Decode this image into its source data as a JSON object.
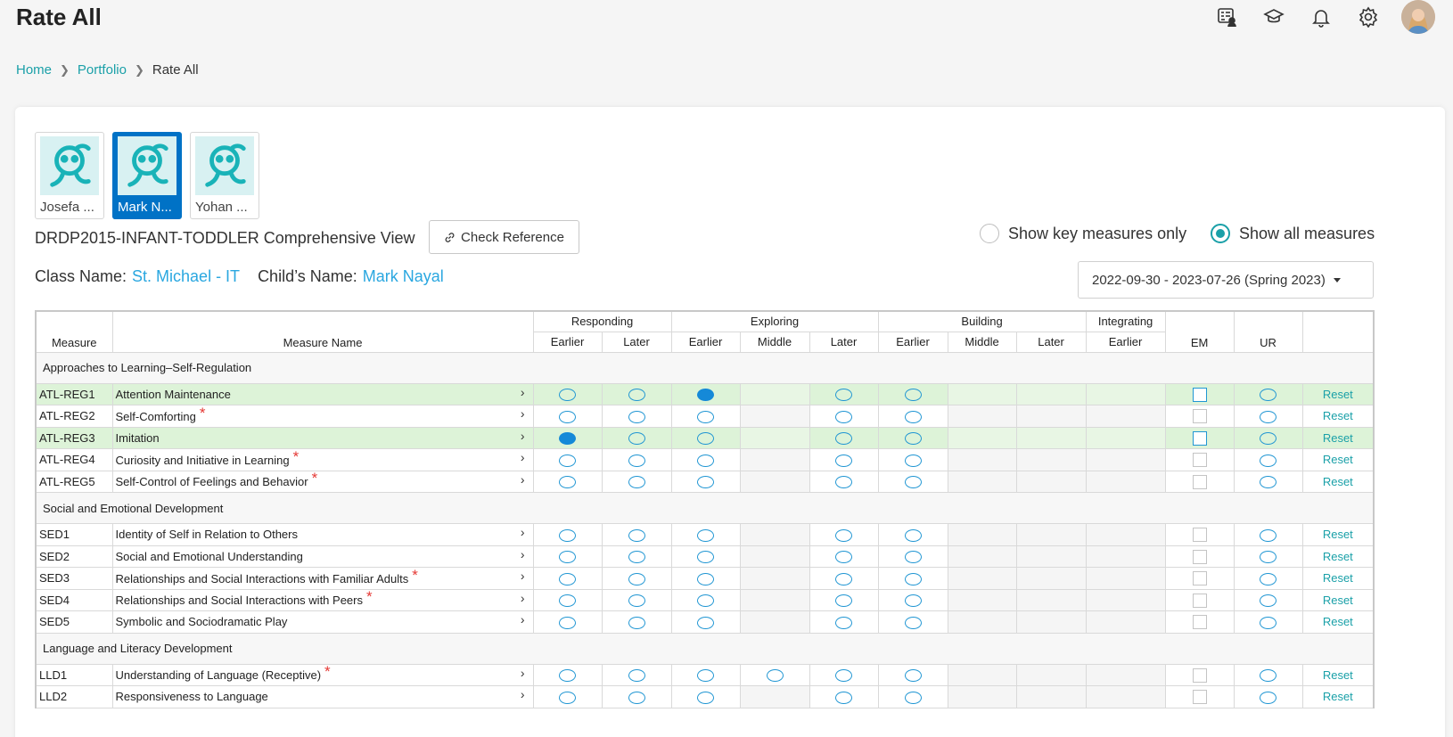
{
  "header": {
    "title": "Rate All"
  },
  "top_icons": [
    "report-icon",
    "graduation-cap-icon",
    "bell-icon",
    "gear-icon"
  ],
  "breadcrumb": {
    "home": "Home",
    "portfolio": "Portfolio",
    "current": "Rate All"
  },
  "children": [
    {
      "name": "Josefa ...",
      "selected": false
    },
    {
      "name": "Mark N...",
      "selected": true
    },
    {
      "name": "Yohan ...",
      "selected": false
    }
  ],
  "view": {
    "title": "DRDP2015-INFANT-TODDLER Comprehensive View",
    "check_reference": "Check Reference",
    "key_measures_label": "Show key measures only",
    "all_measures_label": "Show all measures",
    "selected_option": "all"
  },
  "info": {
    "class_label": "Class Name:",
    "class_value": "St. Michael - IT",
    "child_label": "Child’s Name:",
    "child_value": "Mark Nayal"
  },
  "date_range": "2022-09-30 - 2023-07-26 (Spring 2023)",
  "table": {
    "headers": {
      "measure": "Measure",
      "measure_name": "Measure Name",
      "groups": [
        "Responding",
        "Exploring",
        "Building",
        "Integrating"
      ],
      "levels": [
        "Earlier",
        "Later",
        "Earlier",
        "Middle",
        "Later",
        "Earlier",
        "Middle",
        "Later",
        "Earlier"
      ],
      "em": "EM",
      "ur": "UR"
    },
    "reset_label": "Reset",
    "sections": [
      {
        "title": "Approaches to Learning–Self-Regulation",
        "rows": [
          {
            "code": "ATL-REG1",
            "name": "Attention Maintenance",
            "key": false,
            "highlight": true,
            "selected": 2,
            "middle": false
          },
          {
            "code": "ATL-REG2",
            "name": "Self-Comforting",
            "key": true,
            "highlight": false,
            "selected": -1,
            "middle": false
          },
          {
            "code": "ATL-REG3",
            "name": "Imitation",
            "key": false,
            "highlight": true,
            "selected": 0,
            "middle": false
          },
          {
            "code": "ATL-REG4",
            "name": "Curiosity and Initiative in Learning",
            "key": true,
            "highlight": false,
            "selected": -1,
            "middle": false
          },
          {
            "code": "ATL-REG5",
            "name": "Self-Control of Feelings and Behavior",
            "key": true,
            "highlight": false,
            "selected": -1,
            "middle": false
          }
        ]
      },
      {
        "title": "Social and Emotional Development",
        "rows": [
          {
            "code": "SED1",
            "name": "Identity of Self in Relation to Others",
            "key": false,
            "highlight": false,
            "selected": -1,
            "middle": false
          },
          {
            "code": "SED2",
            "name": "Social and Emotional Understanding",
            "key": false,
            "highlight": false,
            "selected": -1,
            "middle": false
          },
          {
            "code": "SED3",
            "name": "Relationships and Social Interactions with Familiar Adults",
            "key": true,
            "highlight": false,
            "selected": -1,
            "middle": false
          },
          {
            "code": "SED4",
            "name": "Relationships and Social Interactions with Peers",
            "key": true,
            "highlight": false,
            "selected": -1,
            "middle": false
          },
          {
            "code": "SED5",
            "name": "Symbolic and Sociodramatic Play",
            "key": false,
            "highlight": false,
            "selected": -1,
            "middle": false
          }
        ]
      },
      {
        "title": "Language and Literacy Development",
        "rows": [
          {
            "code": "LLD1",
            "name": "Understanding of Language (Receptive)",
            "key": true,
            "highlight": false,
            "selected": -1,
            "middle": true
          },
          {
            "code": "LLD2",
            "name": "Responsiveness to Language",
            "key": false,
            "highlight": false,
            "selected": -1,
            "middle": false
          }
        ]
      }
    ]
  }
}
